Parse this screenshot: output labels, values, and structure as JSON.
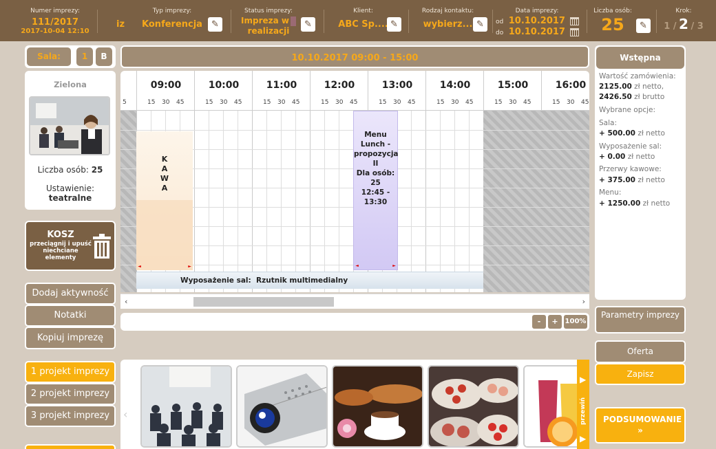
{
  "topbar": {
    "number_label": "Numer imprezy:",
    "number_value": "111/2017",
    "number_date": "2017-10-04 12:10",
    "iz_label": "iz",
    "type_label": "Typ imprezy:",
    "type_value": "Konferencja",
    "status_label": "Status imprezy:",
    "status_value_line1": "Impreza w",
    "status_value_line2": "realizacji",
    "client_label": "Klient:",
    "client_value": "ABC Sp....",
    "contact_label": "Rodzaj kontaktu:",
    "contact_value": "wybierz...",
    "date_label": "Data imprezy:",
    "date_from_prefix": "od",
    "date_from": "10.10.2017",
    "date_to_prefix": "do",
    "date_to": "10.10.2017",
    "persons_label": "Liczba osób:",
    "persons_value": "25",
    "step_label": "Krok:",
    "step_prev": "1 /",
    "step_current": "2",
    "step_next": "/ 3"
  },
  "left": {
    "sala_label": "Sala:",
    "sala_btn1": "1",
    "sala_btn2": "B",
    "room_name": "Zielona",
    "persons_text": "Liczba osób:",
    "persons_value": "25",
    "setting_text": "Ustawienie:",
    "setting_value": "teatralne",
    "trash_title": "KOSZ",
    "trash_sub": "przeciągnij i upuść niechciane elementy",
    "btn_add_activity": "Dodaj aktywność",
    "btn_notes": "Notatki",
    "btn_copy": "Kopiuj imprezę",
    "projects": [
      "1 projekt imprezy",
      "2 projekt imprezy",
      "3 projekt imprezy"
    ]
  },
  "schedule": {
    "date_range": "10.10.2017 09:00 - 15:00",
    "left_min": "5",
    "hours": [
      "09:00",
      "10:00",
      "11:00",
      "12:00",
      "13:00",
      "14:00",
      "15:00",
      "16:00"
    ],
    "minutes": [
      "15",
      "30",
      "45"
    ],
    "event_coffee": [
      "K",
      "A",
      "W",
      "A"
    ],
    "event_menu": [
      "Menu",
      "Lunch -",
      "propozycja",
      "II",
      "Dla osób: 25",
      "12:45 -",
      "13:30"
    ],
    "equipment_bar_label": "Wyposażenie sal:",
    "equipment_bar_value": "Rzutnik multimedialny",
    "zoom_minus": "-",
    "zoom_plus": "+",
    "zoom_level": "100%"
  },
  "calc": {
    "title": "Wstępna kalkulacja",
    "order_value_label": "Wartość zamówienia:",
    "net_value": "2125.00",
    "net_suffix": "zł netto,",
    "gross_value": "2426.50",
    "gross_suffix": "zł brutto",
    "selected_options": "Wybrane opcje:",
    "room_label": "Sala:",
    "room_value": "+ 500.00",
    "equip_label": "Wyposażenie sal:",
    "equip_value": "+ 0.00",
    "coffee_label": "Przerwy kawowe:",
    "coffee_value": "+ 375.00",
    "menu_label": "Menu:",
    "menu_value": "+ 1250.00",
    "net_unit": "zł netto"
  },
  "right_buttons": {
    "params": "Parametry imprezy",
    "offer": "Oferta",
    "save": "Zapisz",
    "summary": "PODSUMOWANIE »"
  },
  "gallery": {
    "next_label": "przewiń"
  }
}
